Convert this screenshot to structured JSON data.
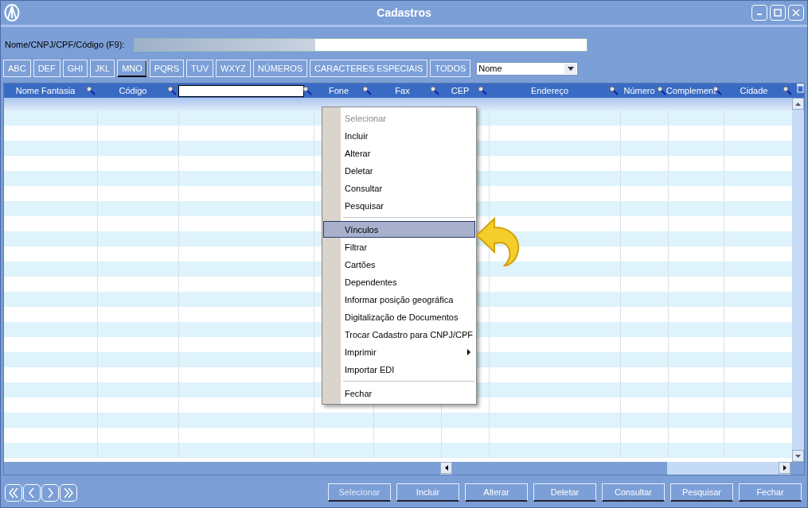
{
  "window": {
    "title": "Cadastros"
  },
  "search": {
    "label": "Nome/CNPJ/CPF/Código (F9):"
  },
  "letter_buttons": [
    {
      "label": "ABC",
      "selected": false
    },
    {
      "label": "DEF",
      "selected": false
    },
    {
      "label": "GHI",
      "selected": false
    },
    {
      "label": "JKL",
      "selected": false
    },
    {
      "label": "MNO",
      "selected": true
    },
    {
      "label": "PQRS",
      "selected": false
    },
    {
      "label": "TUV",
      "selected": false
    },
    {
      "label": "WXYZ",
      "selected": false
    },
    {
      "label": "NÚMEROS",
      "selected": false
    },
    {
      "label": "CARACTERES ESPECIAIS",
      "selected": false
    },
    {
      "label": "TODOS",
      "selected": false
    }
  ],
  "sort_select": {
    "value": "Nome"
  },
  "table": {
    "columns": [
      {
        "kind": "text",
        "label": "Nome Fantasia"
      },
      {
        "kind": "text",
        "label": "Código"
      },
      {
        "kind": "field"
      },
      {
        "kind": "text",
        "label": "Fone"
      },
      {
        "kind": "text",
        "label": "Fax"
      },
      {
        "kind": "text",
        "label": "CEP"
      },
      {
        "kind": "text",
        "label": "Endereço"
      },
      {
        "kind": "text",
        "label": "Número"
      },
      {
        "kind": "text",
        "label": "Complement"
      },
      {
        "kind": "text",
        "label": "Cidade"
      }
    ]
  },
  "context_menu": {
    "items": [
      {
        "kind": "item",
        "label": "Selecionar",
        "disabled": true,
        "selected": false,
        "submenu": false
      },
      {
        "kind": "item",
        "label": "Incluir",
        "disabled": false,
        "selected": false,
        "submenu": false
      },
      {
        "kind": "item",
        "label": "Alterar",
        "disabled": false,
        "selected": false,
        "submenu": false
      },
      {
        "kind": "item",
        "label": "Deletar",
        "disabled": false,
        "selected": false,
        "submenu": false
      },
      {
        "kind": "item",
        "label": "Consultar",
        "disabled": false,
        "selected": false,
        "submenu": false
      },
      {
        "kind": "item",
        "label": "Pesquisar",
        "disabled": false,
        "selected": false,
        "submenu": false
      },
      {
        "kind": "separator"
      },
      {
        "kind": "item",
        "label": "Vínculos",
        "disabled": false,
        "selected": true,
        "submenu": false
      },
      {
        "kind": "item",
        "label": "Filtrar",
        "disabled": false,
        "selected": false,
        "submenu": false
      },
      {
        "kind": "item",
        "label": "Cartões",
        "disabled": false,
        "selected": false,
        "submenu": false
      },
      {
        "kind": "item",
        "label": "Dependentes",
        "disabled": false,
        "selected": false,
        "submenu": false
      },
      {
        "kind": "item",
        "label": "Informar posição geográfica",
        "disabled": false,
        "selected": false,
        "submenu": false
      },
      {
        "kind": "item",
        "label": "Digitalização de Documentos",
        "disabled": false,
        "selected": false,
        "submenu": false
      },
      {
        "kind": "item",
        "label": "Trocar Cadastro para CNPJ/CPF",
        "disabled": false,
        "selected": false,
        "submenu": false
      },
      {
        "kind": "item",
        "label": "Imprimir",
        "disabled": false,
        "selected": false,
        "submenu": true
      },
      {
        "kind": "item",
        "label": "Importar EDI",
        "disabled": false,
        "selected": false,
        "submenu": false
      },
      {
        "kind": "separator"
      },
      {
        "kind": "item",
        "label": "Fechar",
        "disabled": false,
        "selected": false,
        "submenu": false
      }
    ]
  },
  "action_buttons": [
    {
      "label": "Selecionar",
      "disabled": true
    },
    {
      "label": "Incluir",
      "disabled": false
    },
    {
      "label": "Alterar",
      "disabled": false
    },
    {
      "label": "Deletar",
      "disabled": false
    },
    {
      "label": "Consultar",
      "disabled": false
    },
    {
      "label": "Pesquisar",
      "disabled": false
    },
    {
      "label": "Fechar",
      "disabled": false
    }
  ]
}
